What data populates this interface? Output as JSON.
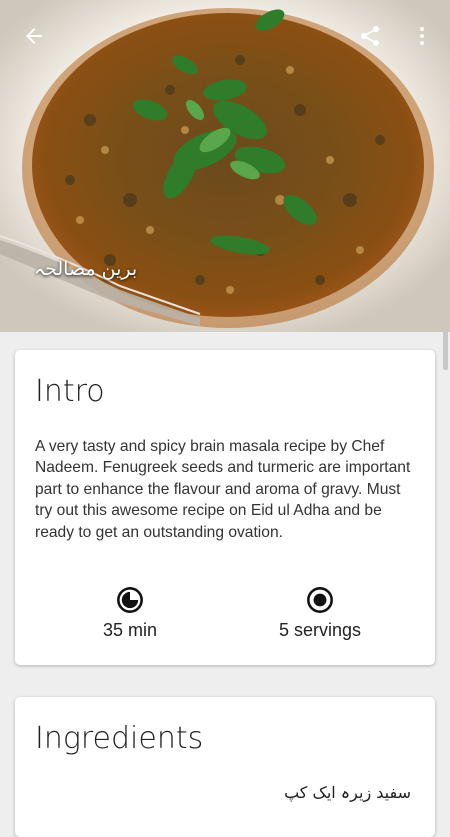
{
  "header": {
    "image_caption": "برین مصالحہ",
    "back_icon": "arrow-back-icon",
    "share_icon": "share-icon",
    "more_icon": "more-vert-icon"
  },
  "intro": {
    "title": "Intro",
    "description": "A very tasty and spicy brain masala recipe by Chef Nadeem. Fenugreek seeds and turmeric are important part to enhance the flavour and aroma of gravy. Must try out this awesome recipe on Eid ul Adha and be ready to get an outstanding ovation.",
    "time_label": "35 min",
    "servings_label": "5 servings",
    "time_icon": "clock-icon",
    "servings_icon": "servings-icon"
  },
  "ingredients": {
    "title": "Ingredients",
    "first_item": "سفید زیرہ ایک کپ"
  },
  "colors": {
    "background": "#eeeeee",
    "card": "#ffffff",
    "text": "#212121"
  }
}
